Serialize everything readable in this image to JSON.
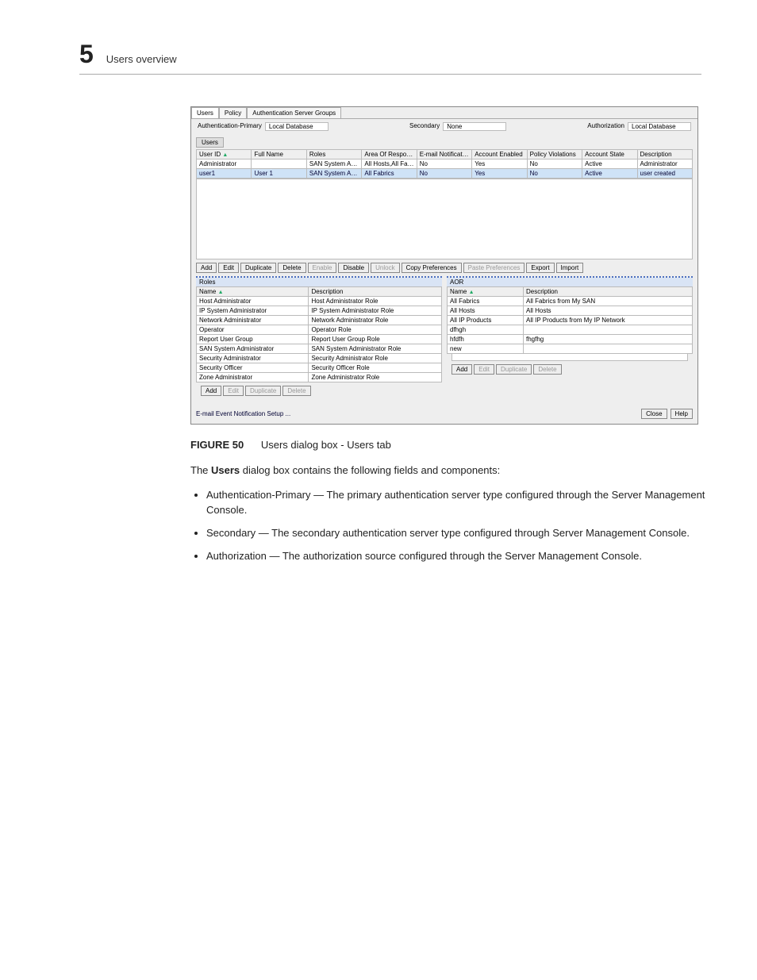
{
  "header": {
    "chapter_number": "5",
    "chapter_title": "Users overview"
  },
  "dialog": {
    "tabs": [
      "Users",
      "Policy",
      "Authentication Server Groups"
    ],
    "auth": {
      "primary_label": "Authentication-Primary",
      "primary_value": "Local Database",
      "secondary_label": "Secondary",
      "secondary_value": "None",
      "authorization_label": "Authorization",
      "authorization_value": "Local Database"
    },
    "users_section_label": "Users",
    "users_table": {
      "columns": [
        "User ID",
        "Full Name",
        "Roles",
        "Area Of Responsi...",
        "E-mail Notification",
        "Account Enabled",
        "Policy Violations",
        "Account State",
        "Description"
      ],
      "rows": [
        {
          "cells": [
            "Administrator",
            "",
            "SAN System Adm...",
            "All Hosts,All Fabri...",
            "No",
            "Yes",
            "No",
            "Active",
            "Administrator"
          ],
          "selected": false
        },
        {
          "cells": [
            "user1",
            "User 1",
            "SAN System Adm...",
            "All Fabrics",
            "No",
            "Yes",
            "No",
            "Active",
            "user created"
          ],
          "selected": true
        }
      ]
    },
    "users_buttons": [
      "Add",
      "Edit",
      "Duplicate",
      "Delete",
      "Enable",
      "Disable",
      "Unlock",
      "Copy Preferences",
      "Paste Preferences",
      "Export",
      "Import"
    ],
    "users_buttons_disabled": [
      "Enable",
      "Unlock",
      "Paste Preferences"
    ],
    "roles_panel": {
      "title": "Roles",
      "columns": [
        "Name",
        "Description"
      ],
      "rows": [
        [
          "Host Administrator",
          "Host Administrator Role"
        ],
        [
          "IP System Administrator",
          "IP System Administrator Role"
        ],
        [
          "Network Administrator",
          "Network Administrator Role"
        ],
        [
          "Operator",
          "Operator Role"
        ],
        [
          "Report User Group",
          "Report User Group Role"
        ],
        [
          "SAN System Administrator",
          "SAN System Administrator Role"
        ],
        [
          "Security Administrator",
          "Security Administrator Role"
        ],
        [
          "Security Officer",
          "Security Officer Role"
        ],
        [
          "Zone Administrator",
          "Zone Administrator Role"
        ]
      ],
      "buttons": [
        "Add",
        "Edit",
        "Duplicate",
        "Delete"
      ],
      "buttons_disabled": [
        "Edit",
        "Duplicate",
        "Delete"
      ]
    },
    "aor_panel": {
      "title": "AOR",
      "columns": [
        "Name",
        "Description"
      ],
      "rows": [
        [
          "All Fabrics",
          "All Fabrics from My SAN"
        ],
        [
          "All Hosts",
          "All Hosts"
        ],
        [
          "All IP Products",
          "All IP Products from My IP Network"
        ],
        [
          "dfhgh",
          ""
        ],
        [
          "hfdfh",
          "fhgfhg"
        ],
        [
          "new",
          ""
        ]
      ],
      "buttons": [
        "Add",
        "Edit",
        "Duplicate",
        "Delete"
      ],
      "buttons_disabled": [
        "Edit",
        "Duplicate",
        "Delete"
      ]
    },
    "footer": {
      "email_link": "E-mail Event Notification Setup ...",
      "close": "Close",
      "help": "Help"
    }
  },
  "figure": {
    "label": "FIGURE 50",
    "caption": "Users dialog box - Users tab"
  },
  "intro_text_prefix": "The ",
  "intro_text_bold": "Users",
  "intro_text_suffix": " dialog box contains the following fields and components:",
  "bullets": [
    "Authentication-Primary — The primary authentication server type configured through the Server Management Console.",
    "Secondary — The secondary authentication server type configured through Server Management Console.",
    "Authorization — The authorization source configured through the Server Management Console."
  ]
}
